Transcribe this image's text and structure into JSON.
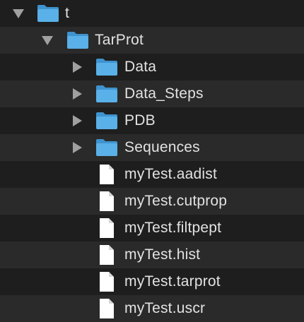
{
  "tree": {
    "root": {
      "label": "t",
      "expanded": true,
      "icon": "folder-icon"
    },
    "child": {
      "label": "TarProt",
      "expanded": true,
      "icon": "folder-icon"
    },
    "items": [
      {
        "label": "Data",
        "type": "folder",
        "expanded": false,
        "icon": "folder-icon"
      },
      {
        "label": "Data_Steps",
        "type": "folder",
        "expanded": false,
        "icon": "folder-icon"
      },
      {
        "label": "PDB",
        "type": "folder",
        "expanded": false,
        "icon": "folder-icon"
      },
      {
        "label": "Sequences",
        "type": "folder",
        "expanded": false,
        "icon": "folder-icon"
      },
      {
        "label": "myTest.aadist",
        "type": "file",
        "icon": "document-icon"
      },
      {
        "label": "myTest.cutprop",
        "type": "file",
        "icon": "document-icon"
      },
      {
        "label": "myTest.filtpept",
        "type": "file",
        "icon": "document-icon"
      },
      {
        "label": "myTest.hist",
        "type": "file",
        "icon": "document-icon"
      },
      {
        "label": "myTest.tarprot",
        "type": "file",
        "icon": "document-icon"
      },
      {
        "label": "myTest.uscr",
        "type": "file",
        "icon": "document-icon"
      }
    ]
  },
  "colors": {
    "background": "#1e1e1e",
    "stripe": "#2a2a2a",
    "text": "#e2e2e2",
    "disclosure": "#a0a0a0",
    "folder_body": "#5ab0e8",
    "folder_tab": "#3f93cf",
    "document": "#ffffff"
  }
}
